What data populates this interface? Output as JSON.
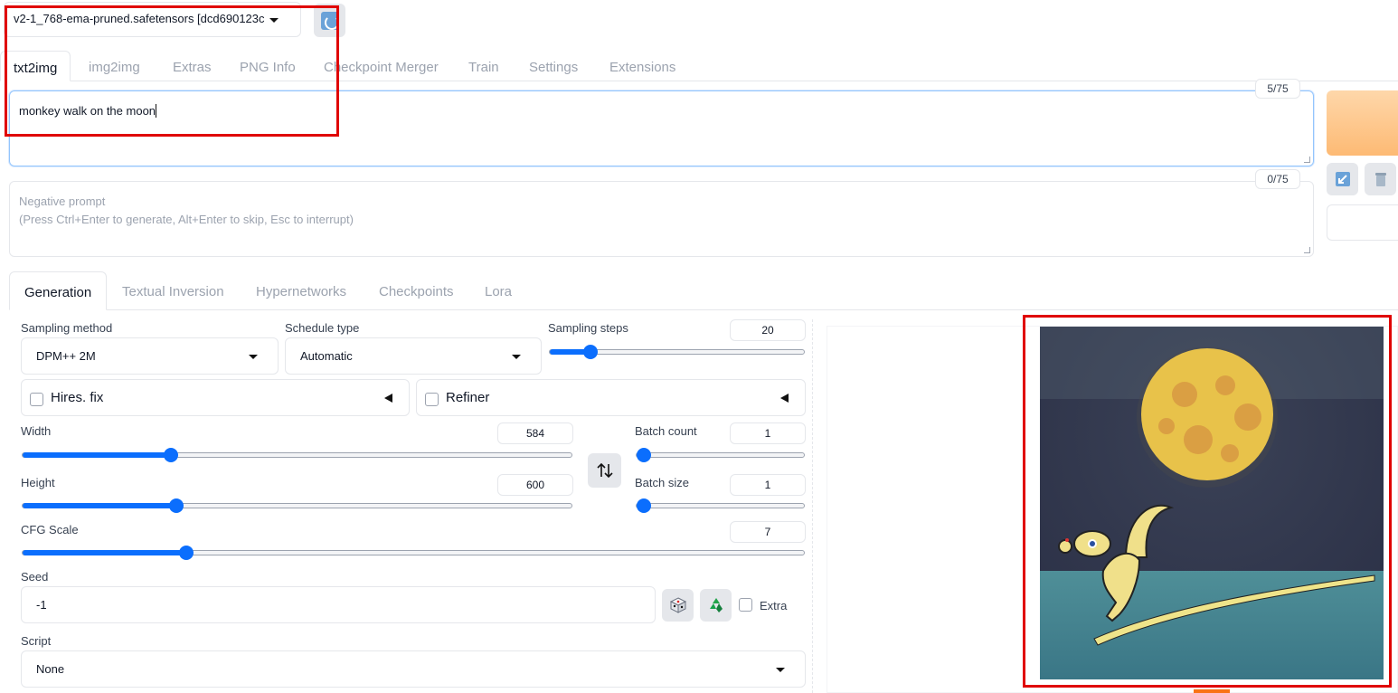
{
  "checkpoint": {
    "selected": "v2-1_768-ema-pruned.safetensors [dcd690123c"
  },
  "main_tabs": [
    "txt2img",
    "img2img",
    "Extras",
    "PNG Info",
    "Checkpoint Merger",
    "Train",
    "Settings",
    "Extensions"
  ],
  "prompt": {
    "text": "monkey walk on the moon",
    "counter": "5/75"
  },
  "negative_prompt": {
    "placeholder_line1": "Negative prompt",
    "placeholder_line2": "(Press Ctrl+Enter to generate, Alt+Enter to skip, Esc to interrupt)",
    "counter": "0/75"
  },
  "sub_tabs": [
    "Generation",
    "Textual Inversion",
    "Hypernetworks",
    "Checkpoints",
    "Lora"
  ],
  "sampling_method": {
    "label": "Sampling method",
    "value": "DPM++ 2M"
  },
  "schedule_type": {
    "label": "Schedule type",
    "value": "Automatic"
  },
  "sampling_steps": {
    "label": "Sampling steps",
    "value": "20",
    "fraction": 0.16
  },
  "hires_fix": {
    "label": "Hires. fix"
  },
  "refiner": {
    "label": "Refiner"
  },
  "width": {
    "label": "Width",
    "value": "584",
    "fraction": 0.27
  },
  "height": {
    "label": "Height",
    "value": "600",
    "fraction": 0.28
  },
  "batch_count": {
    "label": "Batch count",
    "value": "1",
    "fraction": 0.0
  },
  "batch_size": {
    "label": "Batch size",
    "value": "1",
    "fraction": 0.0
  },
  "cfg_scale": {
    "label": "CFG Scale",
    "value": "7",
    "fraction": 0.21
  },
  "seed": {
    "label": "Seed",
    "value": "-1",
    "extra_label": "Extra"
  },
  "script": {
    "label": "Script",
    "value": "None"
  },
  "colors": {
    "accent": "#0b6efd",
    "highlight": "#e00000",
    "generate": "#fdba74"
  }
}
